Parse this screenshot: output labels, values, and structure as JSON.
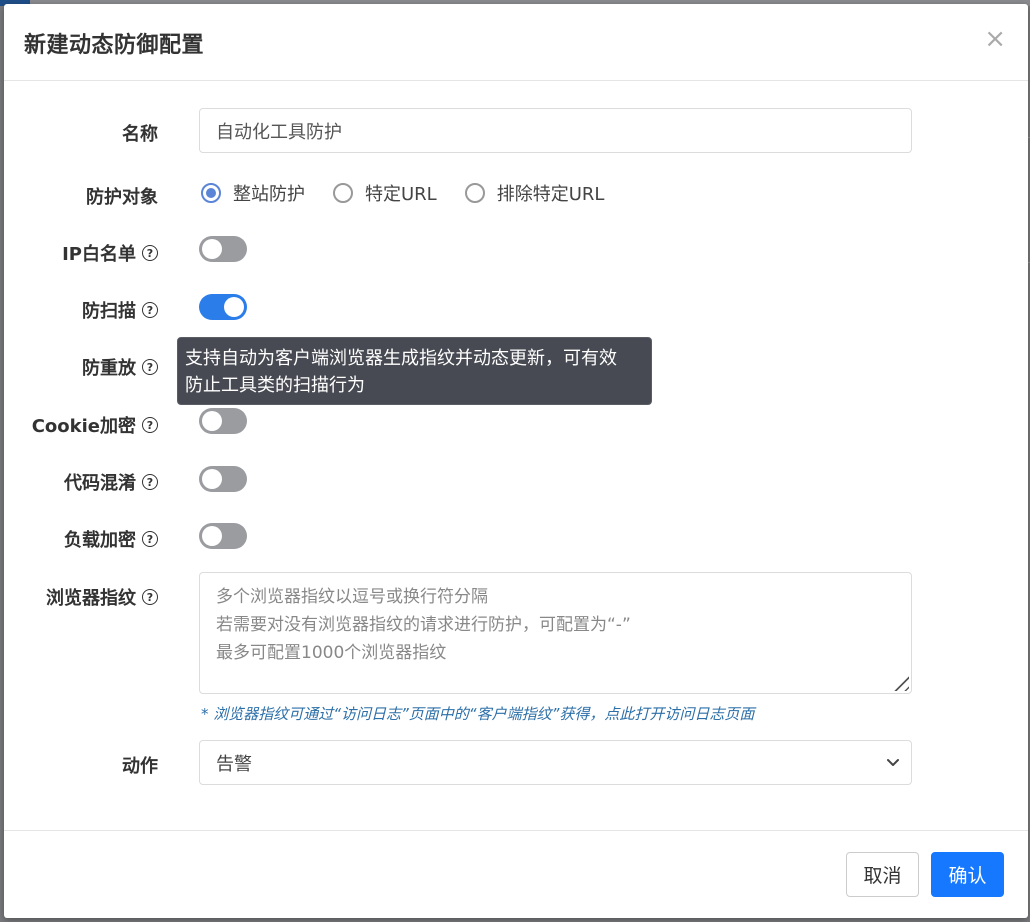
{
  "modal": {
    "title": "新建动态防御配置",
    "close_symbol": "×"
  },
  "form": {
    "name": {
      "label": "名称",
      "value": "自动化工具防护"
    },
    "target": {
      "label": "防护对象",
      "options": [
        "整站防护",
        "特定URL",
        "排除特定URL"
      ],
      "selected": "整站防护"
    },
    "ip_whitelist": {
      "label": "IP白名单",
      "enabled": false
    },
    "anti_scan": {
      "label": "防扫描",
      "enabled": true
    },
    "anti_replay": {
      "label": "防重放"
    },
    "cookie_encrypt": {
      "label": "Cookie加密",
      "enabled": false
    },
    "code_obfuscation": {
      "label": "代码混淆",
      "enabled": false
    },
    "payload_encrypt": {
      "label": "负载加密",
      "enabled": false
    },
    "browser_fingerprint": {
      "label": "浏览器指纹",
      "placeholder_lines": [
        "多个浏览器指纹以逗号或换行符分隔",
        "若需要对没有浏览器指纹的请求进行防护，可配置为“-”",
        "最多可配置1000个浏览器指纹"
      ],
      "hint": "* 浏览器指纹可通过“访问日志”页面中的“客户端指纹”获得，点此打开访问日志页面"
    },
    "action": {
      "label": "动作",
      "selected": "告警"
    }
  },
  "tooltip": {
    "line1": "支持自动为客户端浏览器生成指纹并动态更新，可有效",
    "line2": "防止工具类的扫描行为"
  },
  "help_symbol": "?",
  "footer": {
    "cancel_label": "取消",
    "confirm_label": "确认"
  },
  "colors": {
    "primary": "#1677ff",
    "switch_on": "#2b7de9",
    "switch_off": "#9a9c9f",
    "tooltip_bg": "#474a52",
    "hint_text": "#2c6fa8"
  }
}
